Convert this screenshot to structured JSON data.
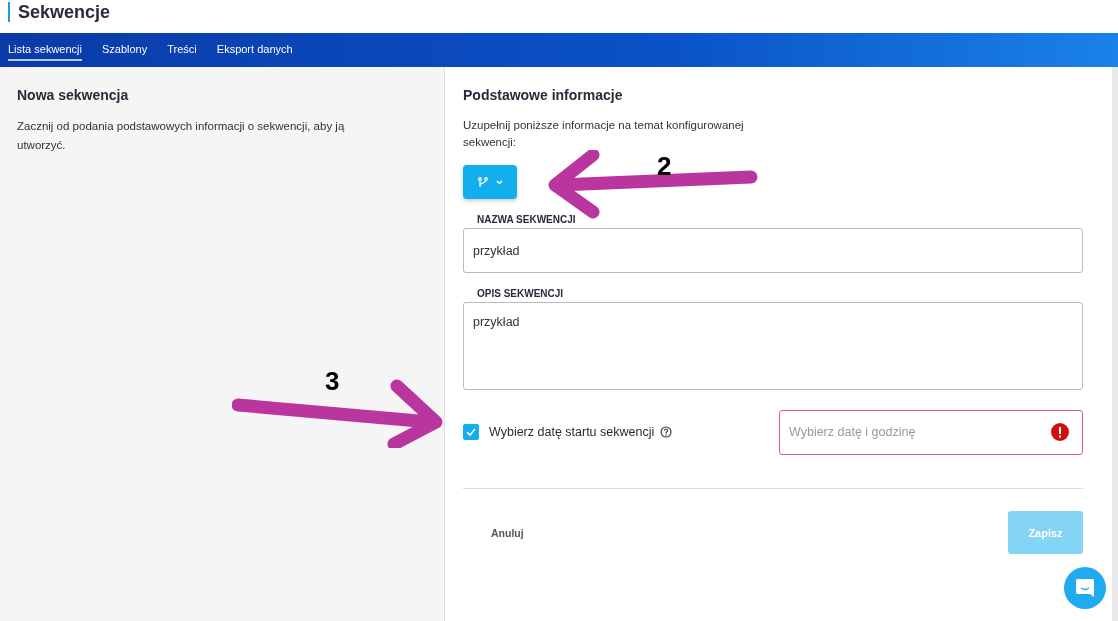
{
  "header": {
    "title": "Sekwencje"
  },
  "tabs": [
    {
      "label": "Lista sekwencji",
      "selected": true
    },
    {
      "label": "Szablony",
      "selected": false
    },
    {
      "label": "Treści",
      "selected": false
    },
    {
      "label": "Eksport danych",
      "selected": false
    }
  ],
  "left_panel": {
    "title": "Nowa sekwencja",
    "description": "Zacznij od podania podstawowych informacji o sekwencji, aby ją utworzyć."
  },
  "form": {
    "title": "Podstawowe informacje",
    "description": "Uzupełnij poniższe informacje na temat konfigurowanej sekwencji:",
    "fields": [
      {
        "kind": "input",
        "label": "NAZWA SEKWENCJI",
        "value": "przykład"
      },
      {
        "kind": "textarea",
        "label": "OPIS SEKWENCJI",
        "value": "przykład"
      }
    ],
    "start_date": {
      "label": "Wybierz datę startu sekwencji",
      "checked": true,
      "placeholder": "Wybierz datę i godzinę",
      "error": true
    },
    "cancel": "Anuluj",
    "save": {
      "label": "Zapisz",
      "disabled": true
    }
  },
  "annotations": [
    {
      "label": "2",
      "kind": "left"
    },
    {
      "label": "3",
      "kind": "right"
    }
  ]
}
